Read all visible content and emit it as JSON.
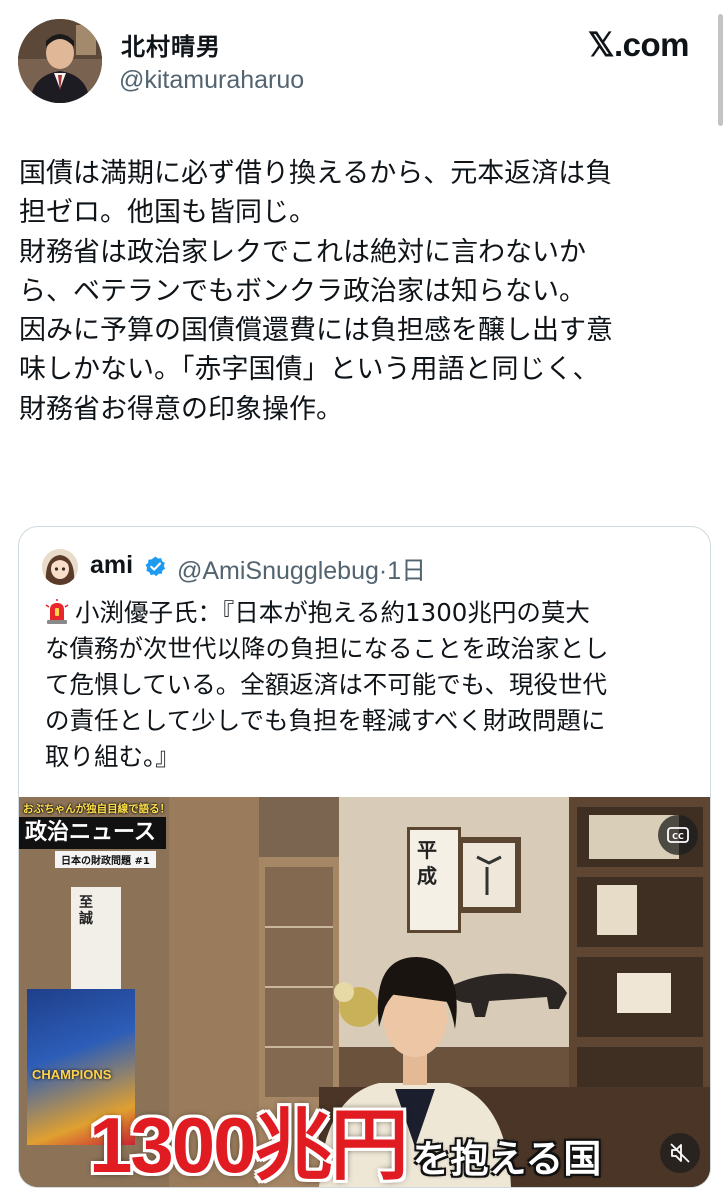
{
  "header": {
    "display_name": "北村晴男",
    "handle": "@kitamuraharuo",
    "brand": "𝕏.com"
  },
  "post": {
    "lines": [
      "国債は満期に必ず借り換えるから、元本返済は負",
      "担ゼロ。他国も皆同じ。",
      "財務省は政治家レクでこれは絶対に言わないか",
      "ら、ベテランでもボンクラ政治家は知らない。",
      "因みに予算の国債償還費には負担感を醸し出す意",
      "味しかない。「赤字国債」という用語と同じく、",
      "財務省お得意の印象操作。"
    ]
  },
  "quote": {
    "name": "ami",
    "handle_time": "@AmiSnugglebug·1日",
    "lines": [
      "小渕優子氏：『日本が抱える約1300兆円の莫大",
      "な債務が次世代以降の負担になることを政治家とし",
      "て危惧している。全額返済は不可能でも、現役世代",
      "の責任として少しでも負担を軽減すべく財政問題に",
      "取り組む。』"
    ],
    "video": {
      "title_small": "おぶちゃんが独自目線で語る！",
      "title_main": "政治ニュース",
      "title_sub": "日本の財政問題 #1",
      "caption_big": "1300兆円",
      "caption_small": "を抱える国",
      "calendar_text": "至誠",
      "scroll_text": "平成",
      "poster_text": "CHAMPIONS"
    }
  },
  "colors": {
    "text": "#0f1419",
    "secondary": "#536471",
    "border": "#cfd9de",
    "verified": "#1d9bf0",
    "caption_red": "#e01c22"
  },
  "icons": [
    "verified-badge-icon",
    "siren-icon",
    "closed-captions-icon",
    "muted-speaker-icon"
  ]
}
